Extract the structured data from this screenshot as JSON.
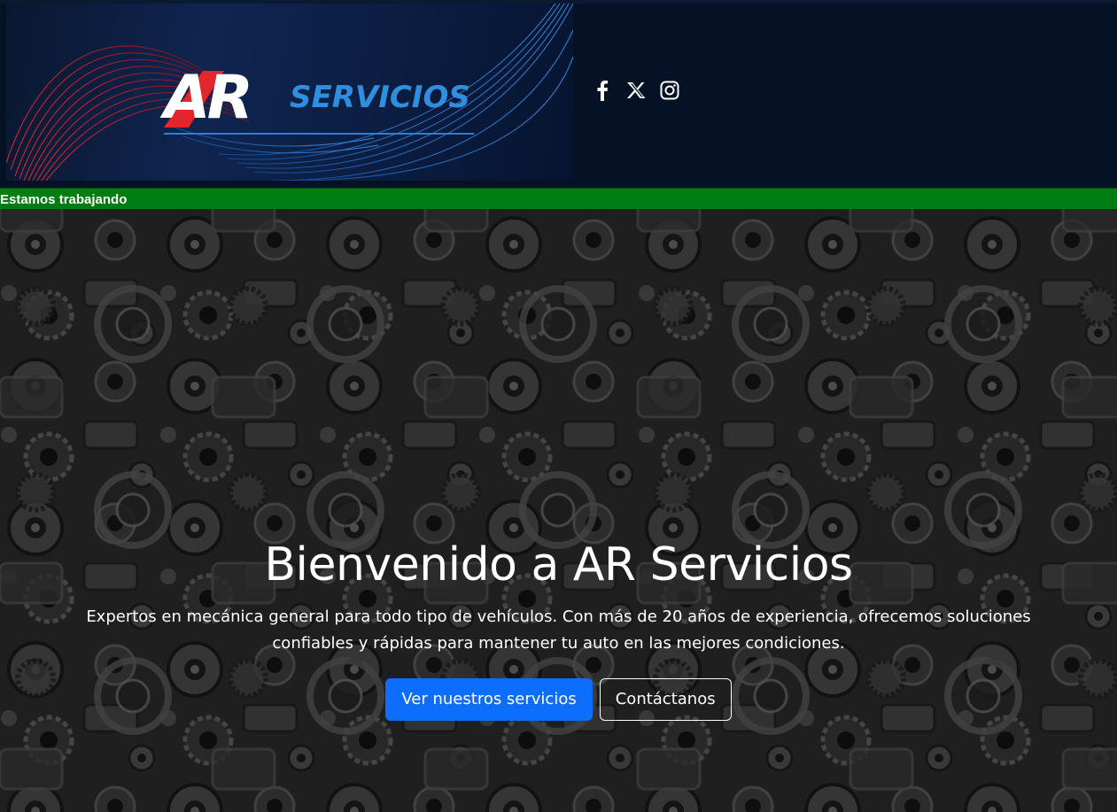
{
  "header": {
    "logo": {
      "mark": "AR",
      "word": "SERVICIOS"
    },
    "social": [
      {
        "name": "facebook-icon"
      },
      {
        "name": "x-icon"
      },
      {
        "name": "instagram-icon"
      }
    ]
  },
  "status_bar": {
    "text": "Estamos trabajando",
    "color": "#007d10"
  },
  "hero": {
    "title": "Bienvenido a AR Servicios",
    "description": "Expertos en mecánica general para todo tipo de vehículos. Con más de 20 años de experiencia, ofrecemos soluciones confiables y rápidas para mantener tu auto en las mejores condiciones.",
    "primary_button": "Ver nuestros servicios",
    "secondary_button": "Contáctanos"
  },
  "colors": {
    "primary_button": "#0d6efd",
    "header_bg": "#051225",
    "logo_blue": "#2e8fe0",
    "logo_red": "#e3262b"
  }
}
